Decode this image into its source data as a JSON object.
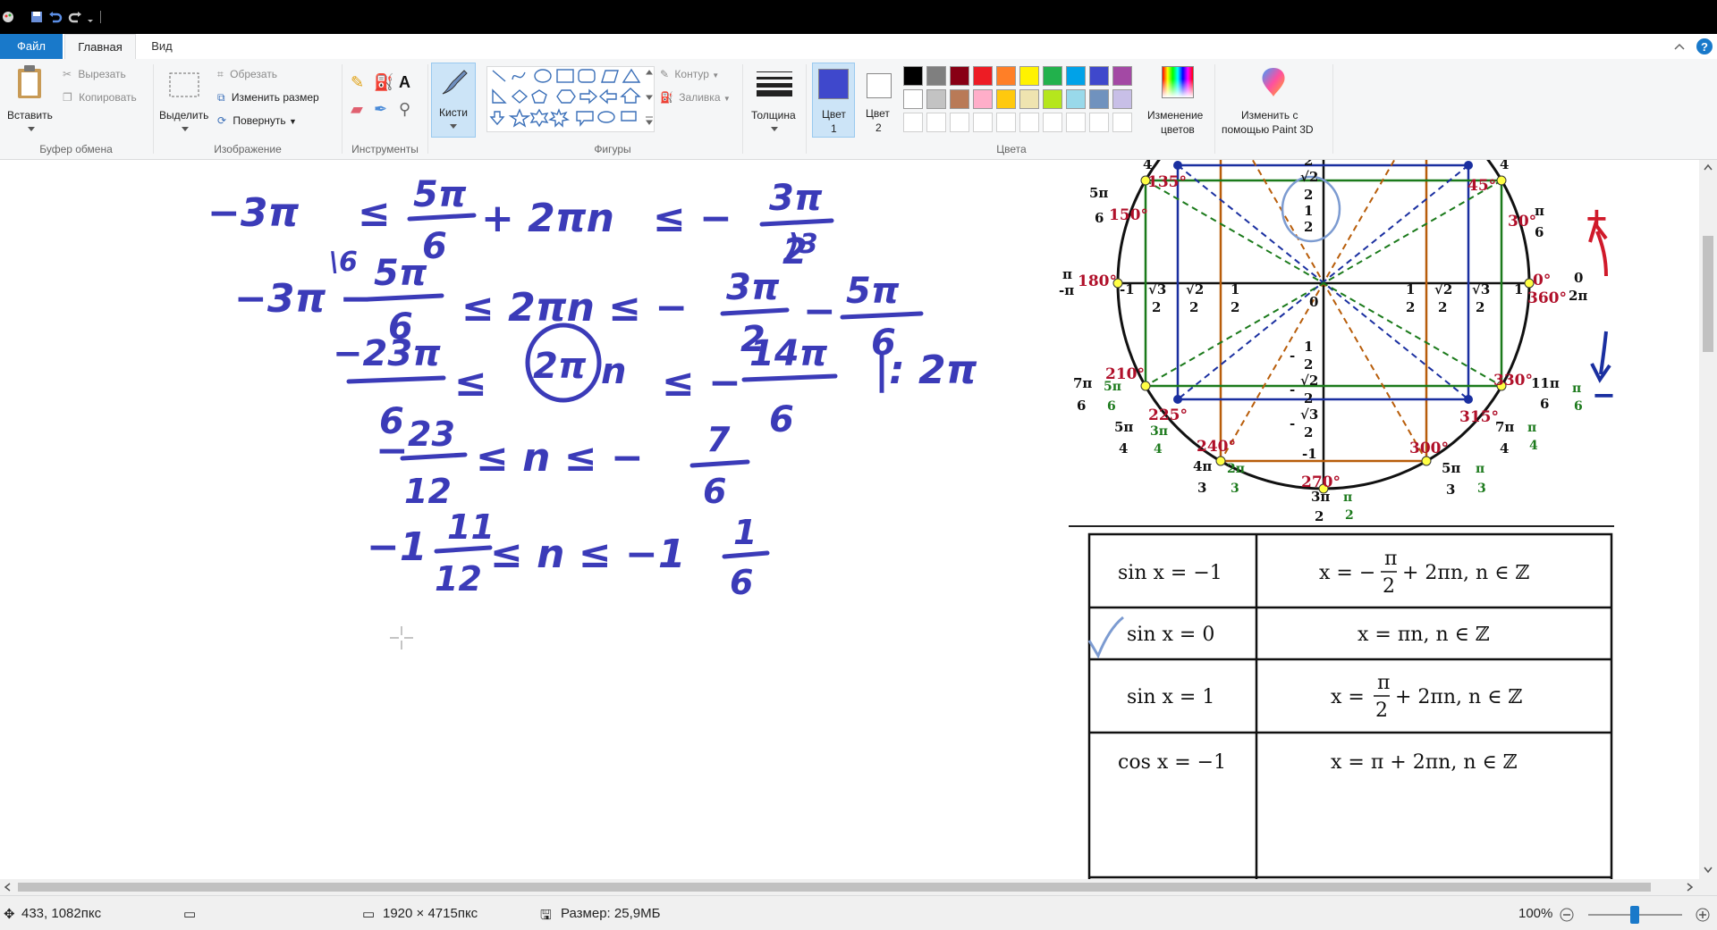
{
  "titlebar": {
    "icons": [
      "paint-app-icon",
      "save-icon",
      "undo-icon",
      "redo-icon",
      "customize-toolbar-icon"
    ]
  },
  "tabs": {
    "file": "Файл",
    "home": "Главная",
    "view": "Вид"
  },
  "ribbon": {
    "clipboard": {
      "paste": "Вставить",
      "cut": "Вырезать",
      "copy": "Копировать",
      "group": "Буфер обмена"
    },
    "image": {
      "select": "Выделить",
      "crop": "Обрезать",
      "resize": "Изменить размер",
      "rotate": "Повернуть",
      "group": "Изображение"
    },
    "tools": {
      "group": "Инструменты"
    },
    "brushes": {
      "label": "Кисти"
    },
    "shapes": {
      "outline": "Контур",
      "fill": "Заливка",
      "group": "Фигуры"
    },
    "size": {
      "label": "Толщина"
    },
    "colors": {
      "color1": "Цвет",
      "color1_num": "1",
      "color2": "Цвет",
      "color2_num": "2",
      "edit_line1": "Изменение",
      "edit_line2": "цветов",
      "paint3d_line1": "Изменить с",
      "paint3d_line2": "помощью Paint 3D",
      "group": "Цвета",
      "color1_value": "#3f48cc",
      "color2_value": "#ffffff",
      "palette_row1": [
        "#000000",
        "#7f7f7f",
        "#880015",
        "#ed1c24",
        "#ff7f27",
        "#fff200",
        "#22b14c",
        "#00a2e8",
        "#3f48cc",
        "#a349a4"
      ],
      "palette_row2": [
        "#ffffff",
        "#c3c3c3",
        "#b97a57",
        "#ffaec9",
        "#ffc90e",
        "#efe4b0",
        "#b5e61d",
        "#99d9ea",
        "#7092be",
        "#c8bfe7"
      ]
    }
  },
  "handwriting": {
    "line1": {
      "a": "−3π",
      "b": "≤",
      "c_num": "5π",
      "c_den": "6",
      "d": "+ 2πn",
      "e": "≤ −",
      "f_num": "3π",
      "f_den": "2",
      "mark": "\\6"
    },
    "line2": {
      "a": "−3π −",
      "b_num": "5π",
      "b_den": "6",
      "c": "≤ 2πn ≤ −",
      "d_num": "3π",
      "d_den": "2",
      "e": "−",
      "f_num": "5π",
      "f_den": "6",
      "mark": ")3"
    },
    "line3": {
      "a_num": "−23π",
      "a_den": "6",
      "b": "≤",
      "c": "2π",
      "d": "n",
      "e": "≤ −",
      "f_num": "14π",
      "f_den": "6",
      "g": "|: 2π"
    },
    "line4": {
      "a": "−",
      "a_num": "23",
      "a_den": "12",
      "b": "≤  n  ≤ −",
      "c_num": "7",
      "c_den": "6"
    },
    "line5": {
      "a": "−1",
      "a_num": "11",
      "a_den": "12",
      "b": "≤  n  ≤ −1",
      "c_num": "1",
      "c_den": "6"
    }
  },
  "unit_circle": {
    "degrees": [
      "135°",
      "45°",
      "150°",
      "30°",
      "180°",
      "0°",
      "360°",
      "210°",
      "330°",
      "225°",
      "315°",
      "240°",
      "300°",
      "270°"
    ],
    "radians": {
      "r_135_den": "4",
      "r_45_den": "4",
      "r_150_num": "5π",
      "r_150_den": "6",
      "r_30_num": "π",
      "r_30_den": "6",
      "r_180_top": "π",
      "r_180_bot": "-π",
      "r_0_top": "0",
      "r_0_bot": "2π",
      "r_210_num": "7π",
      "r_210_den": "6",
      "r_210_alt_num": "5π",
      "r_210_alt_den": "6",
      "r_330_num": "11π",
      "r_330_den": "6",
      "r_330_alt_num": "π",
      "r_330_alt_den": "6",
      "r_225_num": "5π",
      "r_225_den": "4",
      "r_225_alt_num": "3π",
      "r_225_alt_den": "4",
      "r_315_num": "7π",
      "r_315_den": "4",
      "r_315_alt_num": "π",
      "r_315_alt_den": "4",
      "r_240_num": "4π",
      "r_240_den": "3",
      "r_240_alt_num": "2π",
      "r_240_alt_den": "3",
      "r_300_num": "5π",
      "r_300_den": "3",
      "r_300_alt_num": "π",
      "r_300_alt_den": "3",
      "r_270_num": "3π",
      "r_270_den": "2",
      "r_270_alt_num": "π",
      "r_270_alt_den": "2"
    },
    "axis": {
      "neg_one": "-1",
      "one": "1",
      "zero": "0",
      "half": "1",
      "two": "2",
      "sqrt2": "√2",
      "sqrt3": "√3",
      "minus": "-"
    },
    "signs": {
      "plus": "+",
      "minus": "−"
    }
  },
  "formula_table": {
    "rows": [
      {
        "left": "sin x = −1",
        "right": "x = −π/2 + 2πn,  n ∈ ℤ",
        "pre": "x = −",
        "num": "π",
        "den": "2",
        "post": "+ 2πn,  n ∈ ℤ"
      },
      {
        "left": "sin x = 0",
        "right": "x = πn,  n ∈ ℤ"
      },
      {
        "left": "sin x = 1",
        "right": "x = π/2 + 2πn,  n ∈ ℤ",
        "pre": "x =",
        "num": "π",
        "den": "2",
        "post": "+ 2πn,  n ∈ ℤ"
      },
      {
        "left": "cos x = −1",
        "right": "x = π + 2πn,  n ∈ ℤ"
      }
    ]
  },
  "status": {
    "cursor_pos": "433, 1082пкс",
    "canvas_size": "1920 × 4715пкс",
    "file_size": "Размер: 25,9МБ",
    "zoom": "100%"
  }
}
